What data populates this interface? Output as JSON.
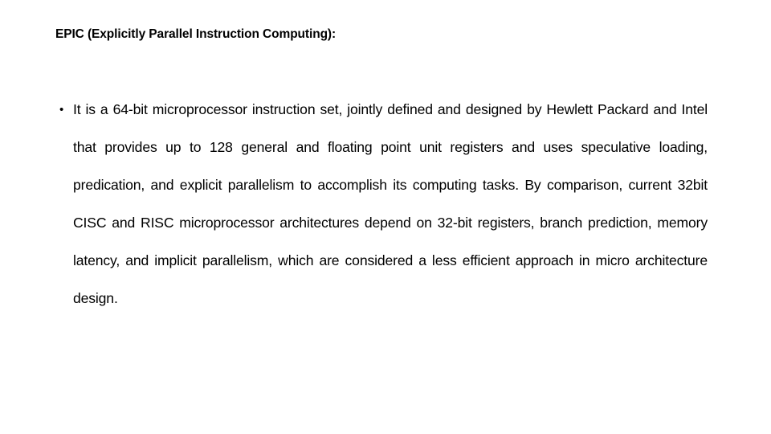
{
  "slide": {
    "background_color": "#ffffff",
    "text_color": "#000000",
    "heading": "EPIC (Explicitly Parallel Instruction Computing):",
    "bullets": [
      {
        "glyph": "•",
        "glyph_name": "bullet-point-icon",
        "text": "It is a 64-bit microprocessor instruction set, jointly defined and designed by Hewlett Packard and Intel that provides up to 128 general and floating point unit registers and uses speculative loading, predication, and explicit parallelism to accomplish its computing tasks. By comparison, current 32bit CISC and RISC microprocessor architectures depend on 32-bit registers, branch prediction, memory latency, and implicit parallelism, which are considered a less efficient approach in micro architecture design."
      }
    ],
    "rendered_lines": [
      "It  is  a  64-bit  microprocessor  instruction  set,  jointly  defined  and",
      "designed  by  Hewlett  Packard  and  Intel  that  provides  up  to  128",
      "general and floating point unit registers and uses speculative loading,",
      "predication, and explicit parallelism to accomplish its computing tasks.",
      "By   comparison,   current   32bit   CISC   and   RISC   microprocessor",
      "architectures depend on 32-bit registers, branch prediction, memory",
      "latency, and implicit parallelism, which are considered a less efficient",
      "approach in micro architecture design."
    ]
  }
}
